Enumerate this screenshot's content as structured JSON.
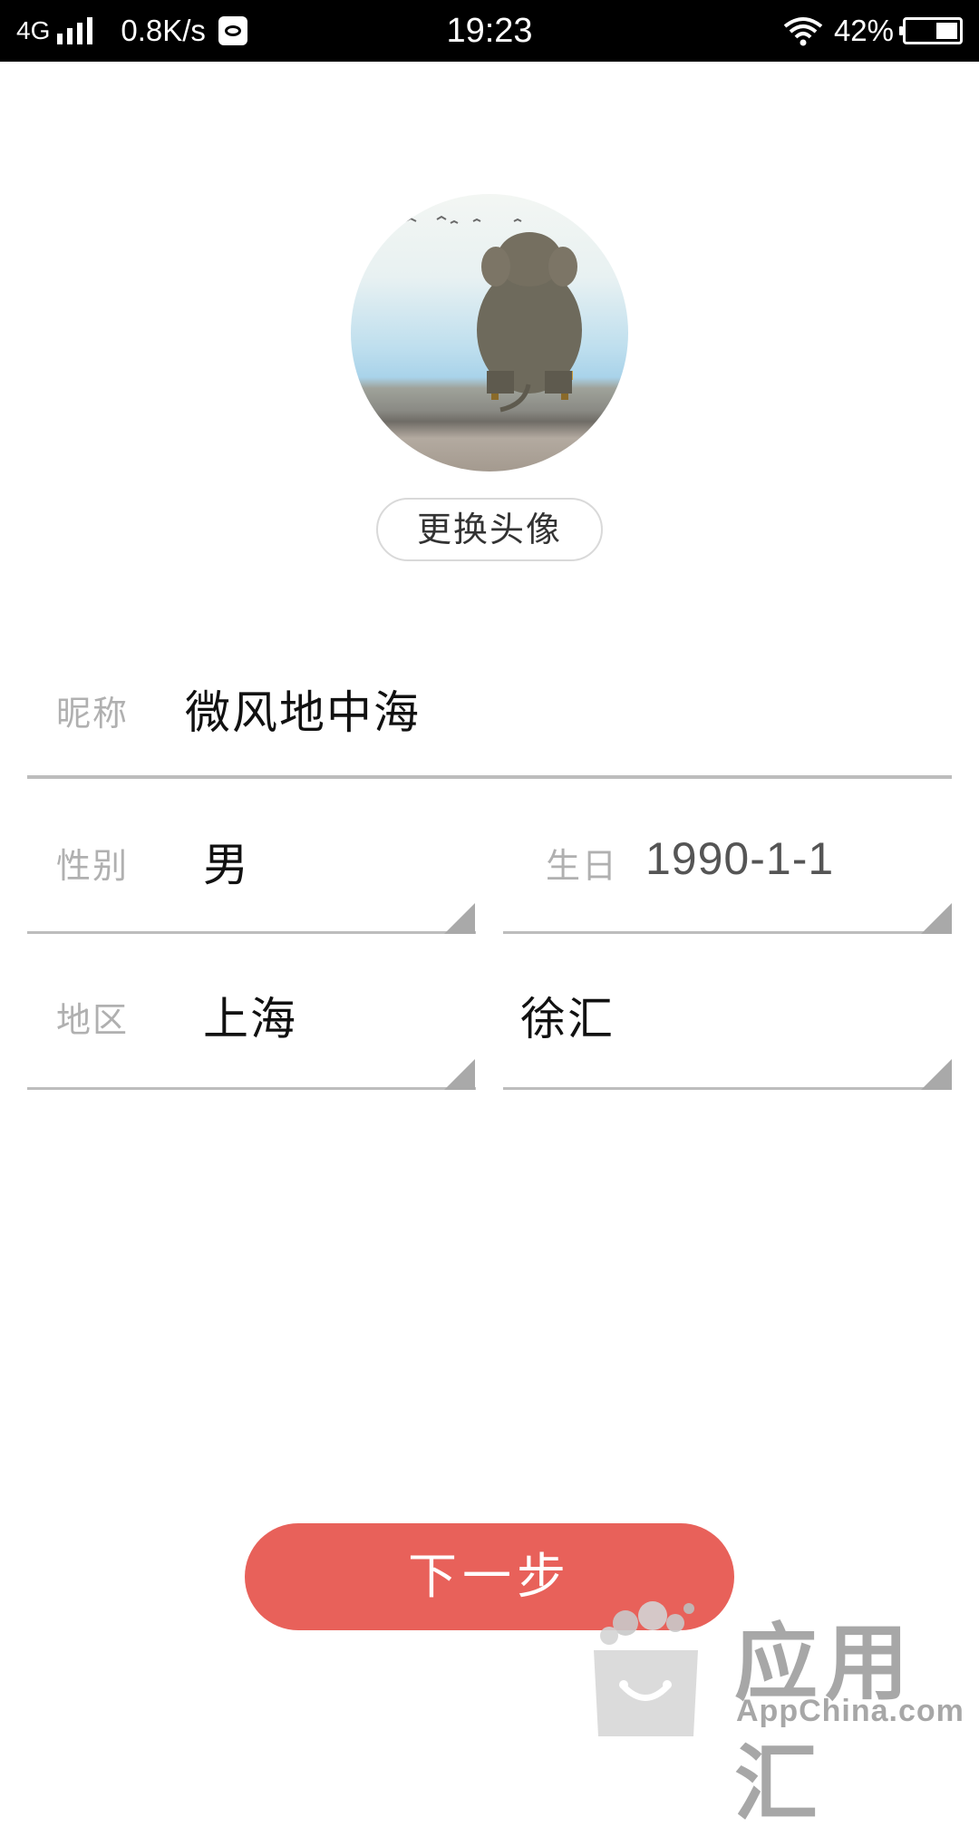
{
  "status_bar": {
    "network": "4G",
    "speed": "0.8K/s",
    "time": "19:23",
    "battery_percent_text": "42%",
    "battery_level": 0.42
  },
  "profile": {
    "change_avatar_label": "更换头像",
    "nickname": {
      "label": "昵称",
      "value": "微风地中海"
    },
    "gender": {
      "label": "性别",
      "value": "男"
    },
    "birthday": {
      "label": "生日",
      "value": "1990-1-1"
    },
    "region": {
      "label": "地区",
      "province": "上海",
      "district": "徐汇"
    }
  },
  "actions": {
    "next_label": "下一步"
  },
  "watermark": {
    "title": "应用汇",
    "subtitle": "AppChina.com"
  },
  "colors": {
    "accent": "#e8615a",
    "label": "#b0b0b0",
    "value": "#111111",
    "divider": "#bdbdbd"
  }
}
